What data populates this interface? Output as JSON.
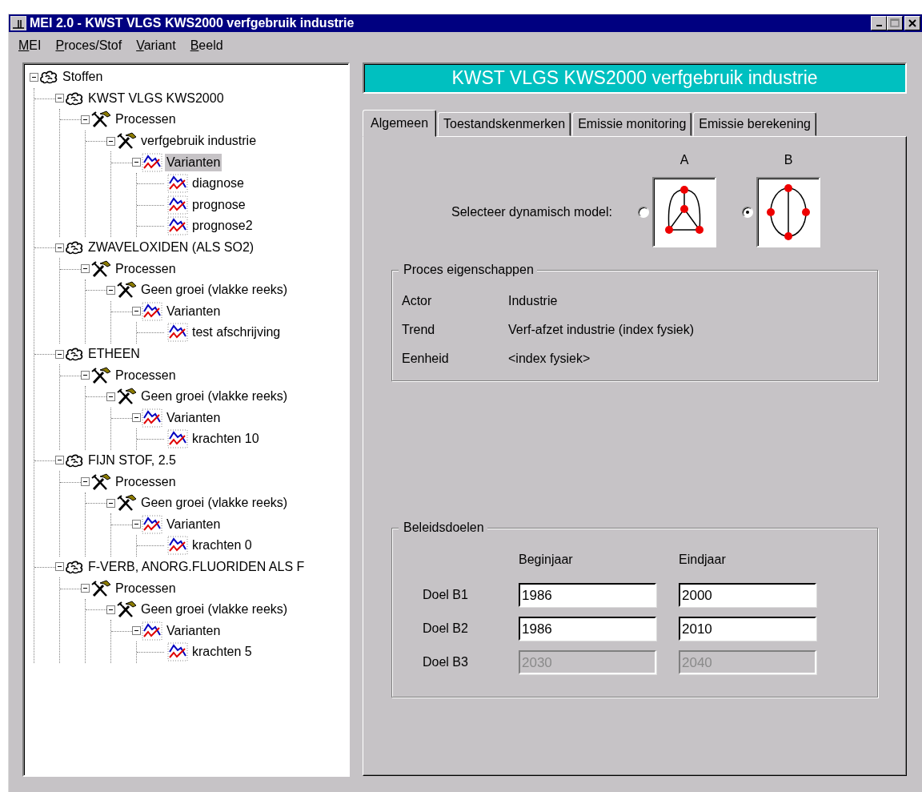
{
  "window": {
    "title": "MEI 2.0 - KWST VLGS KWS2000 verfgebruik industrie"
  },
  "menu": [
    {
      "label": "MEI"
    },
    {
      "label": "Proces/Stof"
    },
    {
      "label": "Variant"
    },
    {
      "label": "Beeld"
    }
  ],
  "tree": [
    {
      "kind": "substance",
      "label": "Stoffen",
      "expanded": true,
      "selected": false,
      "children": [
        {
          "kind": "substance",
          "label": "KWST VLGS KWS2000",
          "expanded": true,
          "selected": false,
          "children": [
            {
              "kind": "process",
              "label": "Processen",
              "expanded": true,
              "selected": false,
              "children": [
                {
                  "kind": "process",
                  "label": "verfgebruik industrie",
                  "expanded": true,
                  "selected": false,
                  "children": [
                    {
                      "kind": "variants",
                      "label": "Varianten",
                      "expanded": true,
                      "selected": true,
                      "children": [
                        {
                          "kind": "variant",
                          "label": "diagnose",
                          "selected": false
                        },
                        {
                          "kind": "variant",
                          "label": "prognose",
                          "selected": false
                        },
                        {
                          "kind": "variant",
                          "label": "prognose2",
                          "selected": false
                        }
                      ]
                    }
                  ]
                }
              ]
            }
          ]
        },
        {
          "kind": "substance",
          "label": "ZWAVELOXIDEN (ALS SO2)",
          "expanded": true,
          "selected": false,
          "children": [
            {
              "kind": "process",
              "label": "Processen",
              "expanded": true,
              "selected": false,
              "children": [
                {
                  "kind": "process",
                  "label": "Geen groei (vlakke reeks)",
                  "expanded": true,
                  "selected": false,
                  "children": [
                    {
                      "kind": "variants",
                      "label": "Varianten",
                      "expanded": true,
                      "selected": false,
                      "children": [
                        {
                          "kind": "variant",
                          "label": "test afschrijving",
                          "selected": false
                        }
                      ]
                    }
                  ]
                }
              ]
            }
          ]
        },
        {
          "kind": "substance",
          "label": "ETHEEN",
          "expanded": true,
          "selected": false,
          "children": [
            {
              "kind": "process",
              "label": "Processen",
              "expanded": true,
              "selected": false,
              "children": [
                {
                  "kind": "process",
                  "label": "Geen groei (vlakke reeks)",
                  "expanded": true,
                  "selected": false,
                  "children": [
                    {
                      "kind": "variants",
                      "label": "Varianten",
                      "expanded": true,
                      "selected": false,
                      "children": [
                        {
                          "kind": "variant",
                          "label": "krachten 10",
                          "selected": false
                        }
                      ]
                    }
                  ]
                }
              ]
            }
          ]
        },
        {
          "kind": "substance",
          "label": "FIJN STOF, 2.5",
          "expanded": true,
          "selected": false,
          "children": [
            {
              "kind": "process",
              "label": "Processen",
              "expanded": true,
              "selected": false,
              "children": [
                {
                  "kind": "process",
                  "label": "Geen groei (vlakke reeks)",
                  "expanded": true,
                  "selected": false,
                  "children": [
                    {
                      "kind": "variants",
                      "label": "Varianten",
                      "expanded": true,
                      "selected": false,
                      "children": [
                        {
                          "kind": "variant",
                          "label": "krachten 0",
                          "selected": false
                        }
                      ]
                    }
                  ]
                }
              ]
            }
          ]
        },
        {
          "kind": "substance",
          "label": "F-VERB, ANORG.FLUORIDEN ALS F",
          "expanded": true,
          "selected": false,
          "children": [
            {
              "kind": "process",
              "label": "Processen",
              "expanded": true,
              "selected": false,
              "children": [
                {
                  "kind": "process",
                  "label": "Geen groei (vlakke reeks)",
                  "expanded": true,
                  "selected": false,
                  "children": [
                    {
                      "kind": "variants",
                      "label": "Varianten",
                      "expanded": true,
                      "selected": false,
                      "children": [
                        {
                          "kind": "variant",
                          "label": "krachten 5",
                          "selected": false
                        }
                      ]
                    }
                  ]
                }
              ]
            }
          ]
        }
      ]
    }
  ],
  "header": {
    "title": "KWST VLGS KWS2000 verfgebruik industrie"
  },
  "tabs": [
    {
      "label": "Algemeen",
      "selected": true
    },
    {
      "label": "Toestandskenmerken",
      "selected": false
    },
    {
      "label": "Emissie monitoring",
      "selected": false
    },
    {
      "label": "Emissie berekening",
      "selected": false
    }
  ],
  "model": {
    "prompt": "Selecteer dynamisch model:",
    "options": [
      {
        "label": "A",
        "kind": "triangle",
        "selected": false
      },
      {
        "label": "B",
        "kind": "cycle",
        "selected": true
      }
    ]
  },
  "properties": {
    "title": "Proces eigenschappen",
    "rows": [
      {
        "key": "Actor",
        "value": "Industrie"
      },
      {
        "key": "Trend",
        "value": "Verf-afzet industrie (index fysiek)"
      },
      {
        "key": "Eenheid",
        "value": "<index fysiek>"
      }
    ]
  },
  "goals": {
    "title": "Beleidsdoelen",
    "columns": [
      "Beginjaar",
      "Eindjaar"
    ],
    "rows": [
      {
        "label": "Doel B1",
        "begin": "1986",
        "end": "2000",
        "disabled": false
      },
      {
        "label": "Doel B2",
        "begin": "1986",
        "end": "2010",
        "disabled": false
      },
      {
        "label": "Doel B3",
        "begin": "2030",
        "end": "2040",
        "disabled": true
      }
    ]
  }
}
